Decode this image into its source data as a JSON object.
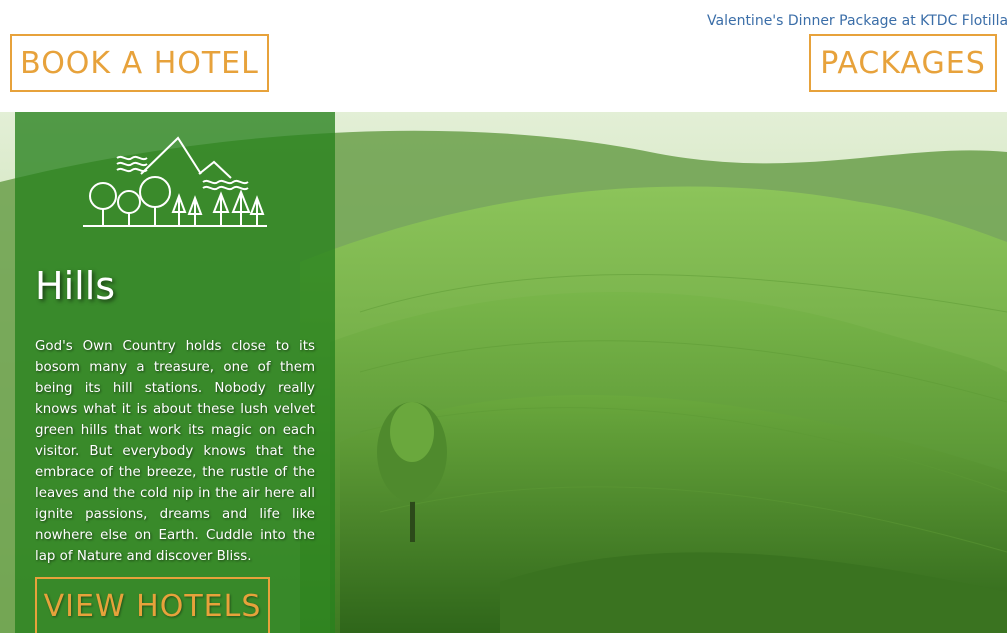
{
  "header": {
    "ticker_text": "Valentine's Dinner Package at KTDC Flotilla, Vembanad Lake",
    "book_hotel_label": "BOOK A HOTEL",
    "packages_label": "PACKAGES"
  },
  "hero": {
    "title": "Hills",
    "description": "God's Own Country holds close to its bosom many a treasure, one of them being its hill stations. Nobody really knows what it is about these lush velvet green hills that work its magic on each visitor. But everybody knows that the embrace of the breeze, the rustle of the leaves and the cold nip in the air here all ignite passions, dreams and life like nowhere else on Earth. Cuddle into the lap of Nature and discover Bliss.",
    "view_hotels_label": "VIEW HOTELS",
    "icon": "hills-trees-icon"
  },
  "colors": {
    "accent": "#e7a23b",
    "ticker": "#3b6ea8",
    "panel": "#28821e"
  }
}
